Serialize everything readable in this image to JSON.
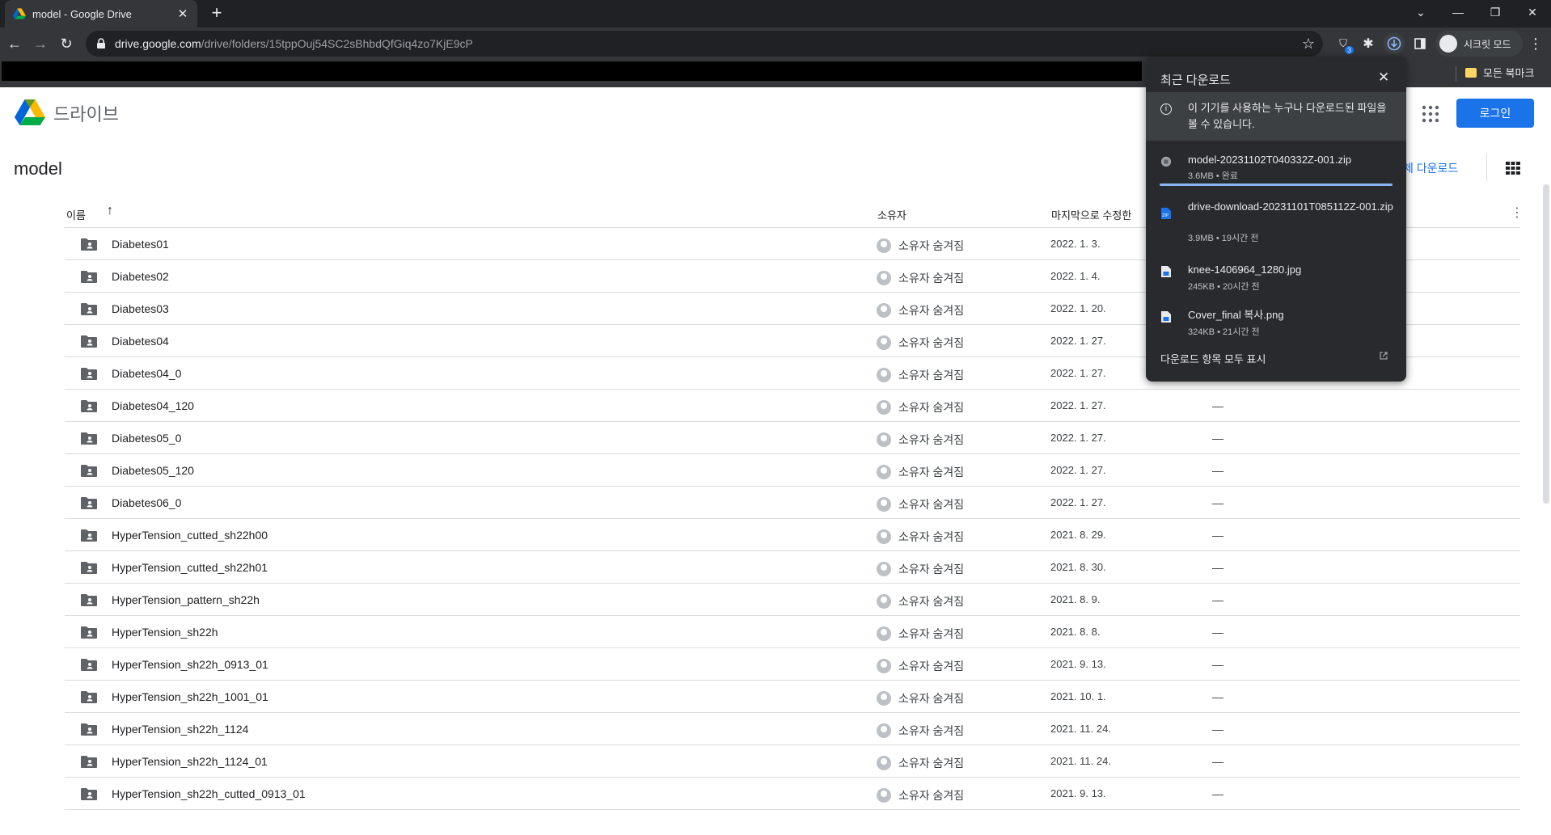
{
  "browser": {
    "tab_title": "model - Google Drive",
    "url_host": "drive.google.com",
    "url_path": "/drive/folders/15tppOuj54SC2sBhbdQfGiq4zo7KjE9cP",
    "ext_badge": "3",
    "incognito_label": "시크릿 모드",
    "bookmarks_label": "모든 북마크",
    "accent": "#1a73e8"
  },
  "drive": {
    "app_name": "드라이브",
    "login_label": "로그인",
    "folder_title": "model",
    "download_all_label": "체 다운로드",
    "columns": {
      "name": "이름",
      "owner": "소유자",
      "modified": "마지막으로 수정한"
    },
    "rows": [
      {
        "name": "Diabetes01",
        "owner": "소유자 숨겨짐",
        "date": "2022. 1. 3.",
        "size": ""
      },
      {
        "name": "Diabetes02",
        "owner": "소유자 숨겨짐",
        "date": "2022. 1. 4.",
        "size": ""
      },
      {
        "name": "Diabetes03",
        "owner": "소유자 숨겨짐",
        "date": "2022. 1. 20.",
        "size": ""
      },
      {
        "name": "Diabetes04",
        "owner": "소유자 숨겨짐",
        "date": "2022. 1. 27.",
        "size": ""
      },
      {
        "name": "Diabetes04_0",
        "owner": "소유자 숨겨짐",
        "date": "2022. 1. 27.",
        "size": ""
      },
      {
        "name": "Diabetes04_120",
        "owner": "소유자 숨겨짐",
        "date": "2022. 1. 27.",
        "size": "—"
      },
      {
        "name": "Diabetes05_0",
        "owner": "소유자 숨겨짐",
        "date": "2022. 1. 27.",
        "size": "—"
      },
      {
        "name": "Diabetes05_120",
        "owner": "소유자 숨겨짐",
        "date": "2022. 1. 27.",
        "size": "—"
      },
      {
        "name": "Diabetes06_0",
        "owner": "소유자 숨겨짐",
        "date": "2022. 1. 27.",
        "size": "—"
      },
      {
        "name": "HyperTension_cutted_sh22h00",
        "owner": "소유자 숨겨짐",
        "date": "2021. 8. 29.",
        "size": "—"
      },
      {
        "name": "HyperTension_cutted_sh22h01",
        "owner": "소유자 숨겨짐",
        "date": "2021. 8. 30.",
        "size": "—"
      },
      {
        "name": "HyperTension_pattern_sh22h",
        "owner": "소유자 숨겨짐",
        "date": "2021. 8. 9.",
        "size": "—"
      },
      {
        "name": "HyperTension_sh22h",
        "owner": "소유자 숨겨짐",
        "date": "2021. 8. 8.",
        "size": "—"
      },
      {
        "name": "HyperTension_sh22h_0913_01",
        "owner": "소유자 숨겨짐",
        "date": "2021. 9. 13.",
        "size": "—"
      },
      {
        "name": "HyperTension_sh22h_1001_01",
        "owner": "소유자 숨겨짐",
        "date": "2021. 10. 1.",
        "size": "—"
      },
      {
        "name": "HyperTension_sh22h_1124",
        "owner": "소유자 숨겨짐",
        "date": "2021. 11. 24.",
        "size": "—"
      },
      {
        "name": "HyperTension_sh22h_1124_01",
        "owner": "소유자 숨겨짐",
        "date": "2021. 11. 24.",
        "size": "—"
      },
      {
        "name": "HyperTension_sh22h_cutted_0913_01",
        "owner": "소유자 숨겨짐",
        "date": "2021. 9. 13.",
        "size": "—"
      }
    ]
  },
  "downloads": {
    "title": "최근 다운로드",
    "notice": "이 기기를 사용하는 누구나 다운로드된 파일을 볼 수 있습니다.",
    "items": [
      {
        "name": "model-20231102T040332Z-001.zip",
        "meta": "3.6MB • 완료",
        "progress": 1.0
      },
      {
        "name": "drive-download-20231101T085112Z-001.zip",
        "meta": "3.9MB • 19시간 전"
      },
      {
        "name": "knee-1406964_1280.jpg",
        "meta": "245KB • 20시간 전"
      },
      {
        "name": "Cover_final 복사.png",
        "meta": "324KB • 21시간 전"
      }
    ],
    "show_all": "다운로드 항목 모두 표시"
  }
}
